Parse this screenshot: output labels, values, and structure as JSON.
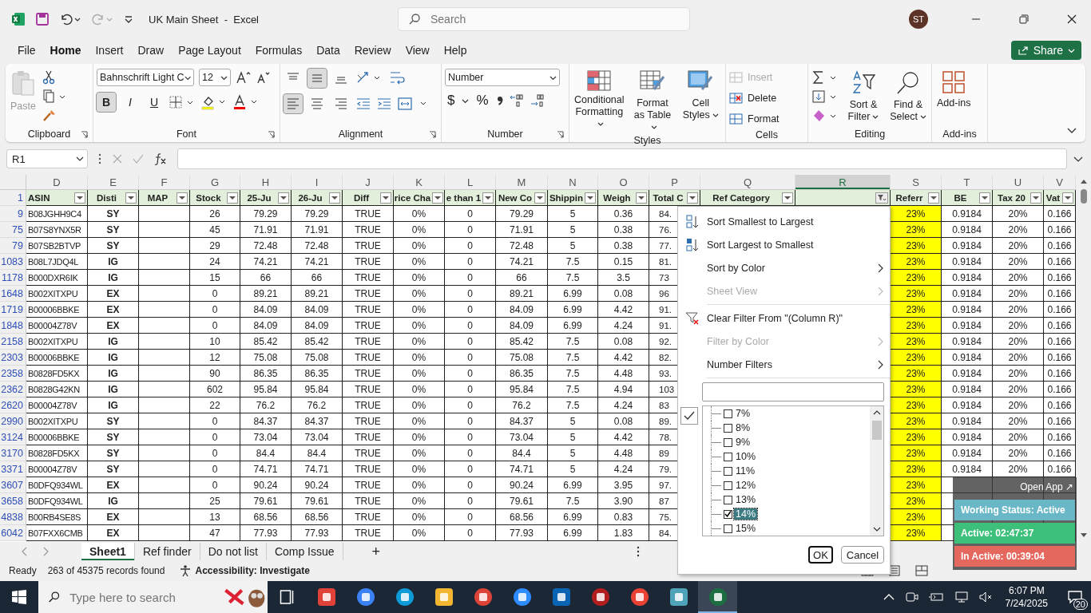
{
  "window": {
    "title": "UK Main Sheet  -  Excel",
    "search_placeholder": "Search",
    "avatar": "ST"
  },
  "menu_tabs": [
    {
      "label": "File",
      "selected": false
    },
    {
      "label": "Home",
      "selected": true
    },
    {
      "label": "Insert",
      "selected": false
    },
    {
      "label": "Draw",
      "selected": false
    },
    {
      "label": "Page Layout",
      "selected": false
    },
    {
      "label": "Formulas",
      "selected": false
    },
    {
      "label": "Data",
      "selected": false
    },
    {
      "label": "Review",
      "selected": false
    },
    {
      "label": "View",
      "selected": false
    },
    {
      "label": "Help",
      "selected": false
    }
  ],
  "share": {
    "label": "Share"
  },
  "ribbon": {
    "clipboard": {
      "label": "Clipboard",
      "paste": "Paste"
    },
    "font": {
      "label": "Font",
      "family": "Bahnschrift Light C",
      "size": "12",
      "style_buttons": [
        {
          "label": "B",
          "pressed": true,
          "kind": "bold"
        },
        {
          "label": "I",
          "pressed": false,
          "kind": "italic"
        },
        {
          "label": "U",
          "pressed": false,
          "kind": "underline"
        }
      ]
    },
    "alignment": {
      "label": "Alignment",
      "vertical": [
        {
          "pressed": false
        },
        {
          "pressed": true
        },
        {
          "pressed": false
        }
      ],
      "horizontal": [
        {
          "pressed": true
        },
        {
          "pressed": false
        },
        {
          "pressed": false
        }
      ]
    },
    "number": {
      "label": "Number",
      "format": "Number",
      "currency": "$",
      "percent": "%"
    },
    "styles": {
      "label": "Styles",
      "buttons": [
        "Conditional Formatting",
        "Format as Table",
        "Cell Styles"
      ]
    },
    "cells": {
      "label": "Cells",
      "buttons": [
        {
          "label": "Insert",
          "disabled": true
        },
        {
          "label": "Delete",
          "disabled": false
        },
        {
          "label": "Format",
          "disabled": false
        }
      ]
    },
    "editing": {
      "label": "Editing",
      "buttons": [
        "Sort & Filter",
        "Find & Select"
      ]
    },
    "addins": {
      "label": "Add-ins",
      "button": "Add-ins"
    }
  },
  "formula_bar": {
    "name_box": "R1"
  },
  "sheet": {
    "columns": [
      {
        "letter": "D",
        "header": "ASIN",
        "kind": "id",
        "selected": false,
        "filtered": false
      },
      {
        "letter": "E",
        "header": "Disti",
        "kind": "code",
        "selected": false,
        "filtered": false
      },
      {
        "letter": "F",
        "header": "MAP",
        "kind": "value",
        "selected": false,
        "filtered": false
      },
      {
        "letter": "G",
        "header": "Stock",
        "kind": "value",
        "selected": false,
        "filtered": false
      },
      {
        "letter": "H",
        "header": "25-Ju",
        "kind": "value",
        "selected": false,
        "filtered": false
      },
      {
        "letter": "I",
        "header": "26-Ju",
        "kind": "value",
        "selected": false,
        "filtered": false
      },
      {
        "letter": "J",
        "header": "Diff",
        "kind": "value",
        "selected": false,
        "filtered": false
      },
      {
        "letter": "K",
        "header": "rice Cha",
        "kind": "value",
        "selected": false,
        "filtered": false
      },
      {
        "letter": "L",
        "header": "e than 1",
        "kind": "value",
        "selected": false,
        "filtered": false
      },
      {
        "letter": "M",
        "header": "New Co",
        "kind": "value",
        "selected": false,
        "filtered": false
      },
      {
        "letter": "N",
        "header": "Shippin",
        "kind": "value",
        "selected": false,
        "filtered": false
      },
      {
        "letter": "O",
        "header": "Weigh",
        "kind": "value",
        "selected": false,
        "filtered": false
      },
      {
        "letter": "P",
        "header": "Total C",
        "kind": "covered",
        "selected": false,
        "filtered": false
      },
      {
        "letter": "Q",
        "header": "Ref Category",
        "kind": "value",
        "selected": false,
        "filtered": false
      },
      {
        "letter": "R",
        "kind": "value",
        "selected": true,
        "filtered": true
      },
      {
        "letter": "S",
        "header": "Referr",
        "kind": "value",
        "selected": false,
        "filtered": false,
        "color": "#ffff00"
      },
      {
        "letter": "T",
        "header": "BE",
        "kind": "value",
        "selected": false,
        "filtered": false
      },
      {
        "letter": "U",
        "header": "Tax 20",
        "kind": "value",
        "selected": false,
        "filtered": false
      },
      {
        "letter": "V",
        "header": "Vat",
        "kind": "value",
        "selected": false,
        "filtered": false
      }
    ],
    "header_row": "1",
    "rows": [
      {
        "row": "9",
        "cells": [
          "B08JGHH9C4",
          "SY",
          null,
          "26",
          "79.29",
          "79.29",
          "TRUE",
          "0%",
          "0",
          "79.29",
          "5",
          "0.36",
          "84.",
          null,
          null,
          "23%",
          "0.9184",
          "20%",
          "0.166"
        ]
      },
      {
        "row": "75",
        "cells": [
          "B07S8YNX5R",
          "SY",
          null,
          "45",
          "71.91",
          "71.91",
          "TRUE",
          "0%",
          "0",
          "71.91",
          "5",
          "0.38",
          "76.",
          null,
          null,
          "23%",
          "0.9184",
          "20%",
          "0.166"
        ]
      },
      {
        "row": "79",
        "cells": [
          "B07SB2BTVP",
          "SY",
          null,
          "29",
          "72.48",
          "72.48",
          "TRUE",
          "0%",
          "0",
          "72.48",
          "5",
          "0.38",
          "77.",
          null,
          null,
          "23%",
          "0.9184",
          "20%",
          "0.166"
        ]
      },
      {
        "row": "1083",
        "cells": [
          "B08L7JDQ4L",
          "IG",
          null,
          "24",
          "74.21",
          "74.21",
          "TRUE",
          "0%",
          "0",
          "74.21",
          "7.5",
          "0.15",
          "81.",
          null,
          null,
          "23%",
          "0.9184",
          "20%",
          "0.166"
        ]
      },
      {
        "row": "1178",
        "cells": [
          "B000DXR6IK",
          "IG",
          null,
          "15",
          "66",
          "66",
          "TRUE",
          "0%",
          "0",
          "66",
          "7.5",
          "3.5",
          "73",
          null,
          null,
          "23%",
          "0.9184",
          "20%",
          "0.166"
        ]
      },
      {
        "row": "1648",
        "cells": [
          "B002XITXPU",
          "EX",
          null,
          "0",
          "89.21",
          "89.21",
          "TRUE",
          "0%",
          "0",
          "89.21",
          "6.99",
          "0.08",
          "96",
          null,
          null,
          "23%",
          "0.9184",
          "20%",
          "0.166"
        ]
      },
      {
        "row": "1719",
        "cells": [
          "B00006BBKE",
          "EX",
          null,
          "0",
          "84.09",
          "84.09",
          "TRUE",
          "0%",
          "0",
          "84.09",
          "6.99",
          "4.42",
          "91.",
          null,
          null,
          "23%",
          "0.9184",
          "20%",
          "0.166"
        ]
      },
      {
        "row": "1848",
        "cells": [
          "B00004Z78V",
          "EX",
          null,
          "0",
          "84.09",
          "84.09",
          "TRUE",
          "0%",
          "0",
          "84.09",
          "6.99",
          "4.24",
          "91.",
          null,
          null,
          "23%",
          "0.9184",
          "20%",
          "0.166"
        ]
      },
      {
        "row": "2158",
        "cells": [
          "B002XITXPU",
          "IG",
          null,
          "10",
          "85.42",
          "85.42",
          "TRUE",
          "0%",
          "0",
          "85.42",
          "7.5",
          "0.08",
          "92.",
          null,
          null,
          "23%",
          "0.9184",
          "20%",
          "0.166"
        ]
      },
      {
        "row": "2303",
        "cells": [
          "B00006BBKE",
          "IG",
          null,
          "12",
          "75.08",
          "75.08",
          "TRUE",
          "0%",
          "0",
          "75.08",
          "7.5",
          "4.42",
          "82.",
          null,
          null,
          "23%",
          "0.9184",
          "20%",
          "0.166"
        ]
      },
      {
        "row": "2358",
        "cells": [
          "B0828FD5KX",
          "IG",
          null,
          "90",
          "86.35",
          "86.35",
          "TRUE",
          "0%",
          "0",
          "86.35",
          "7.5",
          "4.48",
          "93.",
          null,
          null,
          "23%",
          "0.9184",
          "20%",
          "0.166"
        ]
      },
      {
        "row": "2362",
        "cells": [
          "B0828G42KN",
          "IG",
          null,
          "602",
          "95.84",
          "95.84",
          "TRUE",
          "0%",
          "0",
          "95.84",
          "7.5",
          "4.94",
          "103",
          null,
          null,
          "23%",
          "0.9184",
          "20%",
          "0.166"
        ]
      },
      {
        "row": "2620",
        "cells": [
          "B00004Z78V",
          "IG",
          null,
          "22",
          "76.2",
          "76.2",
          "TRUE",
          "0%",
          "0",
          "76.2",
          "7.5",
          "4.24",
          "83",
          null,
          null,
          "23%",
          "0.9184",
          "20%",
          "0.166"
        ]
      },
      {
        "row": "2990",
        "cells": [
          "B002XITXPU",
          "SY",
          null,
          "0",
          "84.37",
          "84.37",
          "TRUE",
          "0%",
          "0",
          "84.37",
          "5",
          "0.08",
          "89.",
          null,
          null,
          "23%",
          "0.9184",
          "20%",
          "0.166"
        ]
      },
      {
        "row": "3124",
        "cells": [
          "B00006BBKE",
          "SY",
          null,
          "0",
          "73.04",
          "73.04",
          "TRUE",
          "0%",
          "0",
          "73.04",
          "5",
          "4.42",
          "78.",
          null,
          null,
          "23%",
          "0.9184",
          "20%",
          "0.166"
        ]
      },
      {
        "row": "3170",
        "cells": [
          "B0828FD5KX",
          "SY",
          null,
          "0",
          "84.4",
          "84.4",
          "TRUE",
          "0%",
          "0",
          "84.4",
          "5",
          "4.48",
          "89",
          null,
          null,
          "23%",
          "0.9184",
          "20%",
          "0.166"
        ]
      },
      {
        "row": "3371",
        "cells": [
          "B00004Z78V",
          "SY",
          null,
          "0",
          "74.71",
          "74.71",
          "TRUE",
          "0%",
          "0",
          "74.71",
          "5",
          "4.24",
          "79.",
          null,
          null,
          "23%",
          "0.9184",
          "20%",
          "0.166"
        ]
      },
      {
        "row": "3607",
        "cells": [
          "B0DFQ934WL",
          "EX",
          null,
          "0",
          "90.24",
          "90.24",
          "TRUE",
          "0%",
          "0",
          "90.24",
          "6.99",
          "3.95",
          "97.",
          null,
          null,
          "23%",
          null,
          null,
          null
        ]
      },
      {
        "row": "3658",
        "cells": [
          "B0DFQ934WL",
          "IG",
          null,
          "25",
          "79.61",
          "79.61",
          "TRUE",
          "0%",
          "0",
          "79.61",
          "7.5",
          "3.90",
          "87",
          null,
          null,
          "23%",
          null,
          null,
          null
        ]
      },
      {
        "row": "4838",
        "cells": [
          "B00RB4SE8S",
          "EX",
          null,
          "13",
          "68.56",
          "68.56",
          "TRUE",
          "0%",
          "0",
          "68.56",
          "6.99",
          "0.83",
          "75.",
          null,
          null,
          "23%",
          null,
          null,
          null
        ]
      },
      {
        "row": "6042",
        "cells": [
          "B07FXX6CMB",
          "EX",
          null,
          "47",
          "77.93",
          "77.93",
          "TRUE",
          "0%",
          "0",
          "77.93",
          "6.99",
          "1.83",
          "84.",
          null,
          null,
          "23%",
          null,
          null,
          null
        ]
      }
    ]
  },
  "filter_menu": {
    "sections": [
      [
        {
          "label": "Sort Smallest to Largest",
          "disabled": false,
          "submenu": false
        },
        {
          "label": "Sort Largest to Smallest",
          "disabled": false,
          "submenu": false
        },
        {
          "label": "Sort by Color",
          "disabled": false,
          "submenu": true
        },
        {
          "label": "Sheet View",
          "disabled": true,
          "submenu": true
        }
      ],
      [
        {
          "label": "Clear Filter From \"(Column R)\"",
          "disabled": false,
          "submenu": false
        },
        {
          "label": "Filter by Color",
          "disabled": true,
          "submenu": true
        },
        {
          "label": "Number Filters",
          "disabled": false,
          "submenu": true
        }
      ]
    ],
    "select_all_checked": true,
    "values": [
      {
        "label": "7%",
        "checked": false,
        "selected": false
      },
      {
        "label": "8%",
        "checked": false,
        "selected": false
      },
      {
        "label": "9%",
        "checked": false,
        "selected": false
      },
      {
        "label": "10%",
        "checked": false,
        "selected": false
      },
      {
        "label": "11%",
        "checked": false,
        "selected": false
      },
      {
        "label": "12%",
        "checked": false,
        "selected": false
      },
      {
        "label": "13%",
        "checked": false,
        "selected": false
      },
      {
        "label": "14%",
        "checked": true,
        "selected": true
      },
      {
        "label": "15%",
        "checked": false,
        "selected": false
      }
    ],
    "ok": "OK",
    "cancel": "Cancel"
  },
  "sheet_tabs": [
    {
      "label": "Sheet1",
      "selected": true
    },
    {
      "label": "Ref finder",
      "selected": false
    },
    {
      "label": "Do not list",
      "selected": false
    },
    {
      "label": "Comp Issue",
      "selected": false
    }
  ],
  "add_sheet": "+",
  "status_bar": {
    "mode": "Ready",
    "records": "263 of 45375 records found",
    "accessibility": "Accessibility: Investigate"
  },
  "tracker": {
    "open_app": "Open App ↗",
    "status": "Working Status: Active",
    "active": "Active: 02:47:37",
    "inactive": "In Active: 00:39:04"
  },
  "taskbar": {
    "search_placeholder": "Type here to search",
    "apps": [
      {
        "active": false
      },
      {
        "active": false
      },
      {
        "active": false
      },
      {
        "active": false
      },
      {
        "active": false
      },
      {
        "active": false
      },
      {
        "active": false
      },
      {
        "active": false
      },
      {
        "active": false
      },
      {
        "active": false
      },
      {
        "active": true
      }
    ],
    "time": "6:07 PM",
    "date": "7/24/2025",
    "notifications": "20"
  }
}
